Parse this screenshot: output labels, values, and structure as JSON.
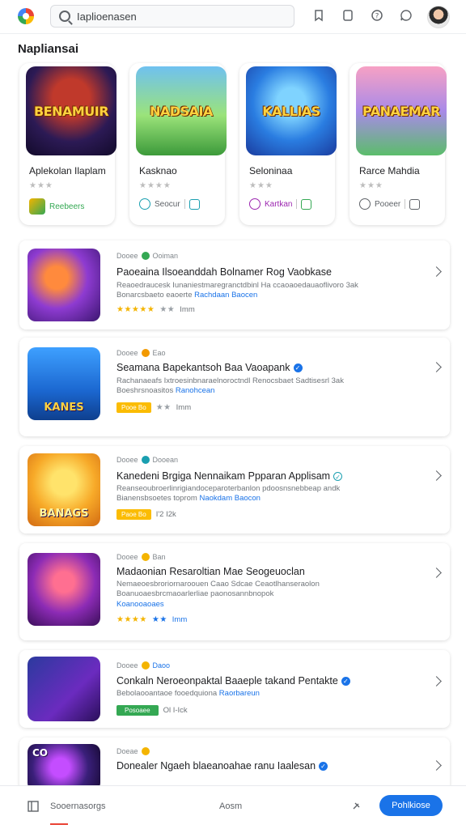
{
  "topbar": {
    "search_value": "Iaplioenasen",
    "icons": [
      "app-logo-icon",
      "search-icon",
      "bookmark-icon",
      "tablet-icon",
      "help-icon",
      "chat-icon",
      "avatar"
    ]
  },
  "section_title": "Napliansai",
  "featured": [
    {
      "title": "Aplekolan Ilaplam",
      "art_label": "BENAMUIR",
      "meta_label": "Reebeers",
      "meta_color": "#34a853"
    },
    {
      "title": "Kasknao",
      "art_label": "NADSAIA",
      "meta_label": "Seocur",
      "meta_color": "#1a9fb0"
    },
    {
      "title": "Seloninaa",
      "art_label": "KALLIAS",
      "meta_label": "Kartkan",
      "meta_color": "#9c27b0"
    },
    {
      "title": "Rarce Mahdia",
      "art_label": "PANAEMAR",
      "meta_label": "Pooeer",
      "meta_color": "#5f6368"
    }
  ],
  "list": [
    {
      "meta_label": "Dooee",
      "meta_sub": "Ooiman",
      "dot_color": "#34a853",
      "title": "Paoeaina Ilsoeanddah Bolnamer Rog Vaobkase",
      "desc1": "Reaoedraucesk Iunaniestmaregranctdbinl Ha ccaoaoedauaoflivoro 3ak",
      "desc2": "Bonarcsbaeto eaoerte",
      "desc2_hl": "Rachdaan Baocen",
      "rating_stars": "★★★★★",
      "rating_muted": "★★",
      "rating_text": "Imm",
      "art_label": "",
      "tag": "",
      "tag_color": ""
    },
    {
      "meta_label": "Dooee",
      "meta_sub": "Eao",
      "dot_color": "#f29900",
      "title": "Seamana Bapekantsoh Baa Vaoapank",
      "desc1": "Rachanaeafs Ixtroesinbnaraelnoroctndl Renocsbaet Sadtisesrl 3ak",
      "desc2": "Boeshrsnoasitos",
      "desc2_hl": "Ranohcean",
      "rating_stars": "",
      "rating_muted": "★★",
      "rating_text": "Imm",
      "art_label": "KANES",
      "tag": "Pooe Bo",
      "tag_color": "#fbbc04"
    },
    {
      "meta_label": "Dooee",
      "meta_sub": "Dooean",
      "dot_color": "#1a9fb0",
      "title": "Kanedeni Brgiga Nennaikam Ppparan Applisam",
      "desc1": "Reanseoubroerlinrigiandoceparoterbanlon pdoosnsnebbeap andk",
      "desc2": "Bianensbsoetes toprom",
      "desc2_hl": "Naokdam Baocon",
      "rating_stars": "",
      "rating_muted": "",
      "rating_text": "I'2 I2k",
      "art_label": "BANAGS",
      "tag": "Paoe Bo",
      "tag_color": "#fbbc04"
    },
    {
      "meta_label": "Dooee",
      "meta_sub": "Ban",
      "dot_color": "#f4b400",
      "title": "Madaonian Resaroltian Mae Seogeuoclan",
      "desc1": "Nemaeoesbroriornaroouen Caao Sdcae Ceaotlhanseraolon",
      "desc2": "Boanuoaesbrcmaoarlerliae paonosannbnopok",
      "desc2_hl": "Koanooaoaes",
      "rating_stars": "★★★★",
      "rating_muted": "★★",
      "rating_text": "Imm",
      "art_label": "",
      "tag": "",
      "tag_color": ""
    },
    {
      "meta_label": "Dooee",
      "meta_sub": "Daoo",
      "dot_color": "#f4b400",
      "title": "Conkaln Neroeonpaktal Baaeple takand Pentakte",
      "desc1": "Bebolaooantaoe fooedquiona",
      "desc2": "",
      "desc2_hl": "Raorbareun",
      "rating_stars": "",
      "rating_muted": "",
      "rating_text": "Ol I-Ick",
      "art_label": "",
      "tag": "Posoaee",
      "tag_color": "#34a853"
    },
    {
      "meta_label": "Doeae",
      "meta_sub": "",
      "dot_color": "#f4b400",
      "title": "Donealer Ngaeh blaeanoahae ranu Iaalesan",
      "desc1": "",
      "desc2": "",
      "desc2_hl": "",
      "rating_stars": "",
      "rating_muted": "",
      "rating_text": "",
      "art_label": "CO",
      "tag": "",
      "tag_color": ""
    }
  ],
  "bottombar": {
    "tab1": "Sooernasorgs",
    "tab2": "Aosm",
    "button": "Pohlkiose"
  }
}
